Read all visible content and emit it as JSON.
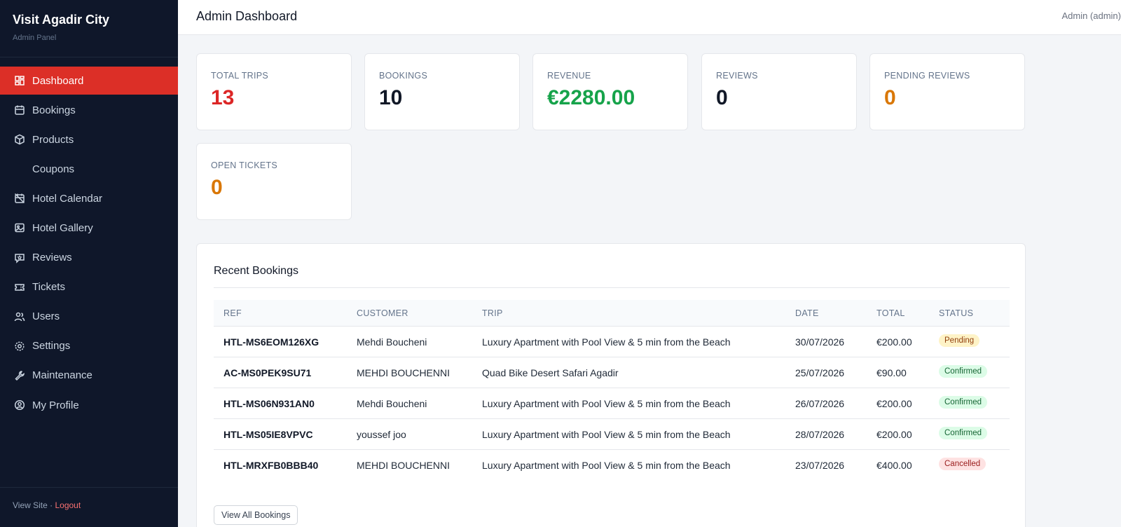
{
  "brand": {
    "title": "Visit Agadir City",
    "subtitle": "Admin Panel"
  },
  "sidebar": {
    "items": [
      {
        "label": "Dashboard",
        "icon": "dashboard-icon",
        "active": true
      },
      {
        "label": "Bookings",
        "icon": "calendar-icon"
      },
      {
        "label": "Products",
        "icon": "box-icon"
      },
      {
        "label": "Coupons",
        "icon": ""
      },
      {
        "label": "Hotel Calendar",
        "icon": "calendar-off-icon"
      },
      {
        "label": "Hotel Gallery",
        "icon": "image-icon"
      },
      {
        "label": "Reviews",
        "icon": "message-star-icon"
      },
      {
        "label": "Tickets",
        "icon": "ticket-icon"
      },
      {
        "label": "Users",
        "icon": "users-icon"
      },
      {
        "label": "Settings",
        "icon": "gear-icon"
      },
      {
        "label": "Maintenance",
        "icon": "wrench-icon"
      },
      {
        "label": "My Profile",
        "icon": "user-circle-icon"
      }
    ],
    "footer": {
      "view_site": "View Site",
      "separator": " · ",
      "logout": "Logout"
    }
  },
  "header": {
    "title": "Admin Dashboard",
    "user": "Admin (admin)"
  },
  "stats": [
    {
      "label": "TOTAL TRIPS",
      "value": "13",
      "color": "#dc2626"
    },
    {
      "label": "BOOKINGS",
      "value": "10",
      "color": "#111827"
    },
    {
      "label": "REVENUE",
      "value": "€2280.00",
      "color": "#16a34a"
    },
    {
      "label": "REVIEWS",
      "value": "0",
      "color": "#111827"
    },
    {
      "label": "PENDING REVIEWS",
      "value": "0",
      "color": "#d97706"
    },
    {
      "label": "OPEN TICKETS",
      "value": "0",
      "color": "#d97706"
    }
  ],
  "recent": {
    "title": "Recent Bookings",
    "columns": [
      "REF",
      "CUSTOMER",
      "TRIP",
      "DATE",
      "TOTAL",
      "STATUS"
    ],
    "rows": [
      {
        "ref": "HTL-MS6EOM126XG",
        "customer": "Mehdi Boucheni",
        "trip": "Luxury Apartment with Pool View & 5 min from the Beach",
        "date": "30/07/2026",
        "total": "€200.00",
        "status": "Pending"
      },
      {
        "ref": "AC-MS0PEK9SU71",
        "customer": "MEHDI BOUCHENNI",
        "trip": "Quad Bike Desert Safari Agadir",
        "date": "25/07/2026",
        "total": "€90.00",
        "status": "Confirmed"
      },
      {
        "ref": "HTL-MS06N931AN0",
        "customer": "Mehdi Boucheni",
        "trip": "Luxury Apartment with Pool View & 5 min from the Beach",
        "date": "26/07/2026",
        "total": "€200.00",
        "status": "Confirmed"
      },
      {
        "ref": "HTL-MS05IE8VPVC",
        "customer": "youssef joo",
        "trip": "Luxury Apartment with Pool View & 5 min from the Beach",
        "date": "28/07/2026",
        "total": "€200.00",
        "status": "Confirmed"
      },
      {
        "ref": "HTL-MRXFB0BBB40",
        "customer": "MEHDI BOUCHENNI",
        "trip": "Luxury Apartment with Pool View & 5 min from the Beach",
        "date": "23/07/2026",
        "total": "€400.00",
        "status": "Cancelled"
      }
    ],
    "view_all": "View All Bookings"
  }
}
